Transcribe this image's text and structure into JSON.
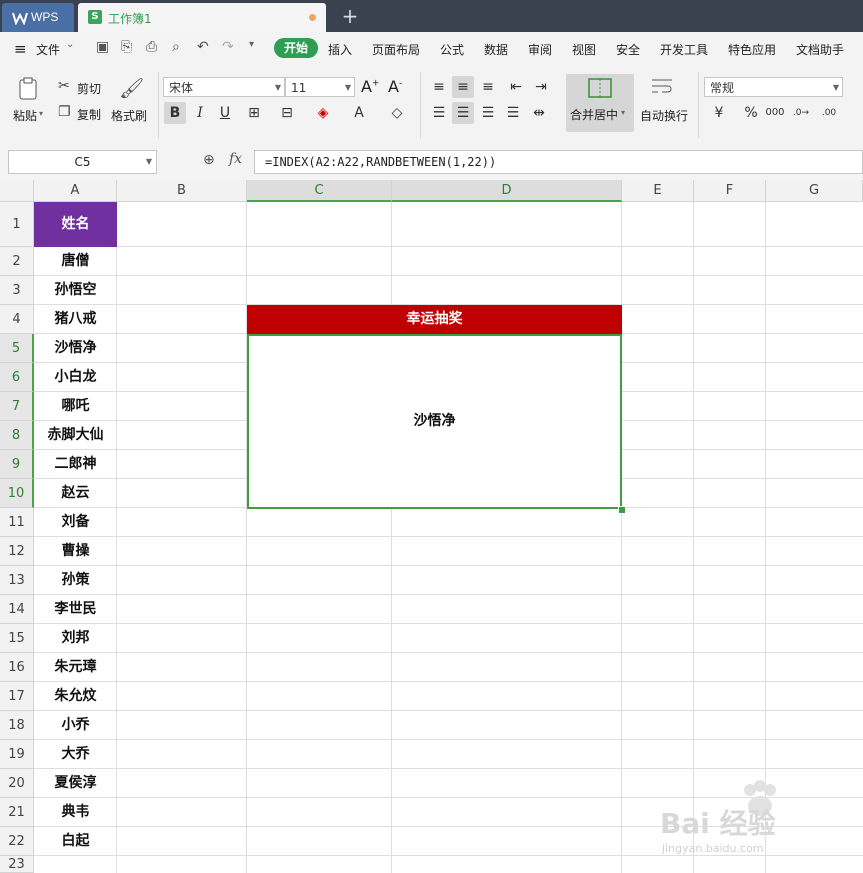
{
  "titlebar": {
    "app_tab": "WPS",
    "doc_tab": "工作簿1",
    "new_tab": "+"
  },
  "menu": {
    "file": "文件",
    "items": [
      "开始",
      "插入",
      "页面布局",
      "公式",
      "数据",
      "审阅",
      "视图",
      "安全",
      "开发工具",
      "特色应用",
      "文档助手"
    ]
  },
  "ribbon": {
    "paste": "粘贴",
    "cut": "剪切",
    "copy": "复制",
    "format_painter": "格式刷",
    "font_name": "宋体",
    "font_size": "11",
    "bold": "B",
    "italic": "I",
    "underline": "U",
    "merge_center": "合并居中",
    "wrap_text": "自动换行",
    "number_format": "常规",
    "percent": "%"
  },
  "formula_bar": {
    "name_box": "C5",
    "fx": "fx",
    "formula": "=INDEX(A2:A22,RANDBETWEEN(1,22))"
  },
  "sheet": {
    "columns": [
      "A",
      "B",
      "C",
      "D",
      "E",
      "F",
      "G"
    ],
    "rows": [
      "1",
      "2",
      "3",
      "4",
      "5",
      "6",
      "7",
      "8",
      "9",
      "10",
      "11",
      "12",
      "13",
      "14",
      "15",
      "16",
      "17",
      "18",
      "19",
      "20",
      "21",
      "22",
      "23"
    ],
    "header_cell": "姓名",
    "names": [
      "唐僧",
      "孙悟空",
      "猪八戒",
      "沙悟净",
      "小白龙",
      "哪吒",
      "赤脚大仙",
      "二郎神",
      "赵云",
      "刘备",
      "曹操",
      "孙策",
      "李世民",
      "刘邦",
      "朱元璋",
      "朱允炆",
      "小乔",
      "大乔",
      "夏侯淳",
      "典韦",
      "白起"
    ],
    "lucky_title": "幸运抽奖",
    "result": "沙悟净"
  },
  "watermark": {
    "brand": "Bai 经验",
    "url": "jingyan.baidu.com"
  },
  "colors": {
    "title_bar": "#3a4250",
    "accent_green": "#2e9e53",
    "header_purple": "#7030a0",
    "lucky_red": "#c00000",
    "selection_green": "#3f9c3f"
  }
}
